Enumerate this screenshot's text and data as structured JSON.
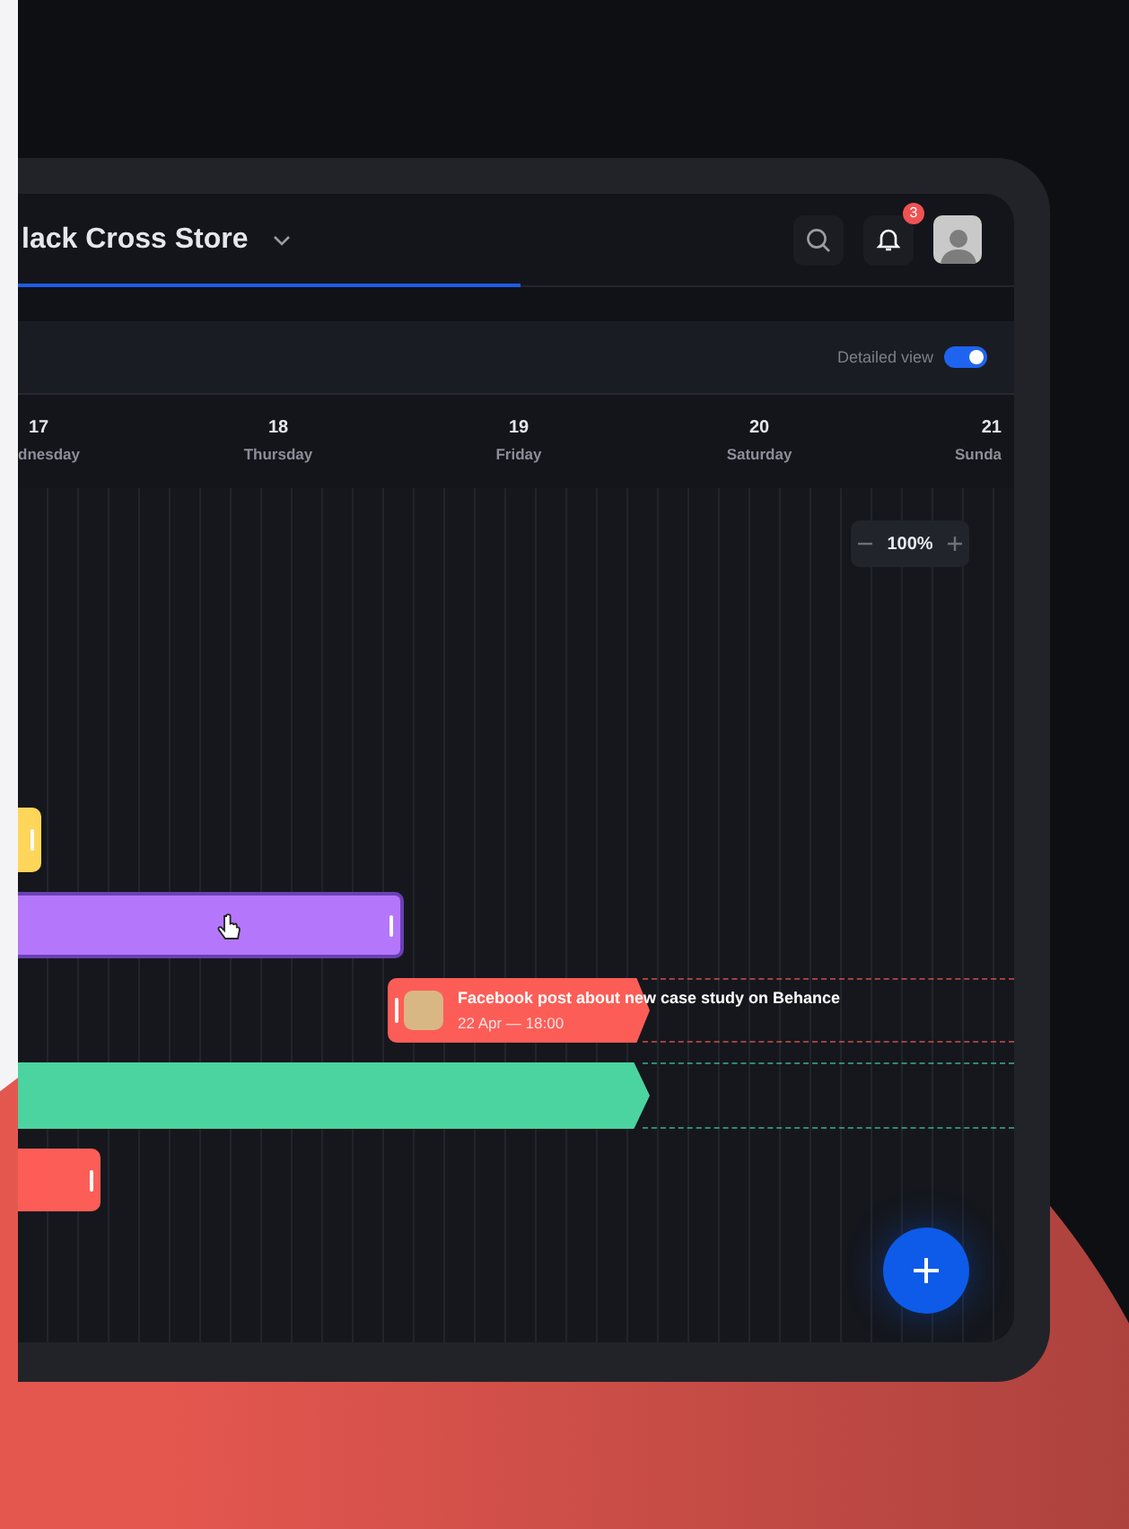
{
  "header": {
    "title": "lack Cross Store",
    "notifications": {
      "badge": "3"
    }
  },
  "toolbar": {
    "toggle": {
      "label": "Detailed view",
      "on": true
    }
  },
  "days": [
    {
      "number": "17",
      "name": "dnesday"
    },
    {
      "number": "18",
      "name": "Thursday"
    },
    {
      "number": "19",
      "name": "Friday"
    },
    {
      "number": "20",
      "name": "Saturday"
    },
    {
      "number": "21",
      "name": "Sunda"
    }
  ],
  "zoom": {
    "value": "100%"
  },
  "events": [
    {
      "kind": "bar",
      "color": "#ffd55a"
    },
    {
      "kind": "bar",
      "color": "#b476fb",
      "selected": true
    },
    {
      "kind": "post",
      "color": "#fd5d57",
      "title": "Facebook post about new case study on Behance",
      "time": "22 Apr — 18:00"
    },
    {
      "kind": "arrow",
      "color": "#4bd49f"
    },
    {
      "kind": "bar",
      "color": "#fd5d57",
      "selected": false
    }
  ]
}
